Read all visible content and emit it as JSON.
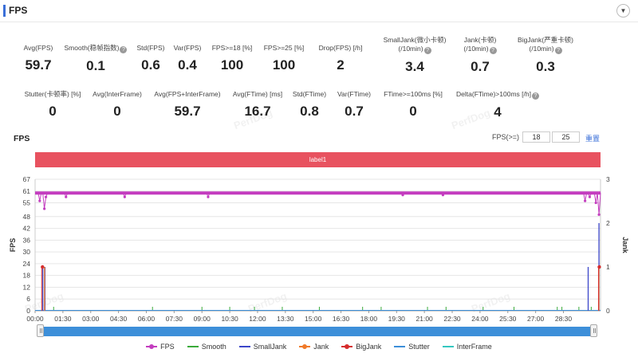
{
  "header": {
    "title": "FPS",
    "collapse_icon": "chevron-down-icon",
    "collapse_glyph": "▼"
  },
  "stats_row1": [
    {
      "label": "Avg(FPS)",
      "value": "59.7",
      "help": false
    },
    {
      "label": "Smooth(稳帧指数)",
      "value": "0.1",
      "help": true
    },
    {
      "label": "Std(FPS)",
      "value": "0.6",
      "help": false
    },
    {
      "label": "Var(FPS)",
      "value": "0.4",
      "help": false
    },
    {
      "label": "FPS>=18 [%]",
      "value": "100",
      "help": false
    },
    {
      "label": "FPS>=25 [%]",
      "value": "100",
      "help": false
    },
    {
      "label": "Drop(FPS) [/h]",
      "value": "2",
      "help": false
    },
    {
      "label": "SmallJank(微小卡顿)",
      "label2": "(/10min)",
      "value": "3.4",
      "help": true
    },
    {
      "label": "Jank(卡顿)",
      "label2": "(/10min)",
      "value": "0.7",
      "help": true
    },
    {
      "label": "BigJank(严重卡顿)",
      "label2": "(/10min)",
      "value": "0.3",
      "help": true
    }
  ],
  "stats_row2": [
    {
      "label": "Stutter(卡顿率) [%]",
      "value": "0",
      "help": false
    },
    {
      "label": "Avg(InterFrame)",
      "value": "0",
      "help": false
    },
    {
      "label": "Avg(FPS+InterFrame)",
      "value": "59.7",
      "help": false
    },
    {
      "label": "Avg(FTime) [ms]",
      "value": "16.7",
      "help": false
    },
    {
      "label": "Std(FTime)",
      "value": "0.8",
      "help": false
    },
    {
      "label": "Var(FTime)",
      "value": "0.7",
      "help": false
    },
    {
      "label": "FTime>=100ms [%]",
      "value": "0",
      "help": false
    },
    {
      "label": "Delta(FTime)>100ms [/h]",
      "value": "4",
      "help": true
    }
  ],
  "help_glyph": "?",
  "watermark": "PerfDog",
  "chart_header": {
    "title": "FPS",
    "threshold_label": "FPS(>=)",
    "threshold1": "18",
    "threshold2": "25",
    "reset_label": "重置"
  },
  "label_bar": {
    "text": "label1",
    "color": "#e8525f"
  },
  "chart_data": {
    "type": "line",
    "ylabel": "FPS",
    "y2label": "Jank",
    "y_ticks": [
      "0",
      "6",
      "12",
      "18",
      "24",
      "30",
      "36",
      "42",
      "48",
      "55",
      "61",
      "67"
    ],
    "ylim": [
      0,
      67
    ],
    "y2_ticks": [
      "0",
      "1",
      "2",
      "3"
    ],
    "y2lim": [
      0,
      3
    ],
    "x_ticks": [
      "00:00",
      "01:30",
      "03:00",
      "04:30",
      "06:00",
      "07:30",
      "09:00",
      "10:30",
      "12:00",
      "13:30",
      "15:00",
      "16:30",
      "18:00",
      "19:30",
      "21:00",
      "22:30",
      "24:00",
      "25:30",
      "27:00",
      "28:30"
    ],
    "x_range_seconds": [
      0,
      1830
    ],
    "grid": true,
    "legend_position": "bottom",
    "fps_baseline": 60,
    "fps_dips": [
      {
        "t": 15,
        "v": 56
      },
      {
        "t": 30,
        "v": 52
      },
      {
        "t": 35,
        "v": 58
      },
      {
        "t": 100,
        "v": 58
      },
      {
        "t": 290,
        "v": 58
      },
      {
        "t": 560,
        "v": 58
      },
      {
        "t": 1190,
        "v": 59
      },
      {
        "t": 1320,
        "v": 59
      },
      {
        "t": 1780,
        "v": 56
      },
      {
        "t": 1795,
        "v": 58
      },
      {
        "t": 1815,
        "v": 55
      },
      {
        "t": 1825,
        "v": 49
      }
    ],
    "smalljank_events": [
      {
        "t": 25,
        "v": 1
      },
      {
        "t": 32,
        "v": 1
      },
      {
        "t": 1790,
        "v": 1
      },
      {
        "t": 1825,
        "v": 2
      }
    ],
    "jank_events": [
      {
        "t": 28,
        "v": 1
      },
      {
        "t": 1822,
        "v": 1
      }
    ],
    "bigjank_events": [
      {
        "t": 24,
        "v": 1
      },
      {
        "t": 1826,
        "v": 1
      }
    ],
    "smooth_spikes_seconds": [
      60,
      380,
      540,
      630,
      710,
      800,
      920,
      1060,
      1120,
      1270,
      1330,
      1450,
      1550,
      1690,
      1705,
      1760,
      1800
    ],
    "series": [
      {
        "name": "FPS",
        "color": "#c33dbf"
      },
      {
        "name": "Smooth",
        "color": "#3aaa3a"
      },
      {
        "name": "SmallJank",
        "color": "#3c46c9"
      },
      {
        "name": "Jank",
        "color": "#f07a2a"
      },
      {
        "name": "BigJank",
        "color": "#d62d2d"
      },
      {
        "name": "Stutter",
        "color": "#3d8fd9"
      },
      {
        "name": "InterFrame",
        "color": "#34c7c0"
      }
    ]
  }
}
